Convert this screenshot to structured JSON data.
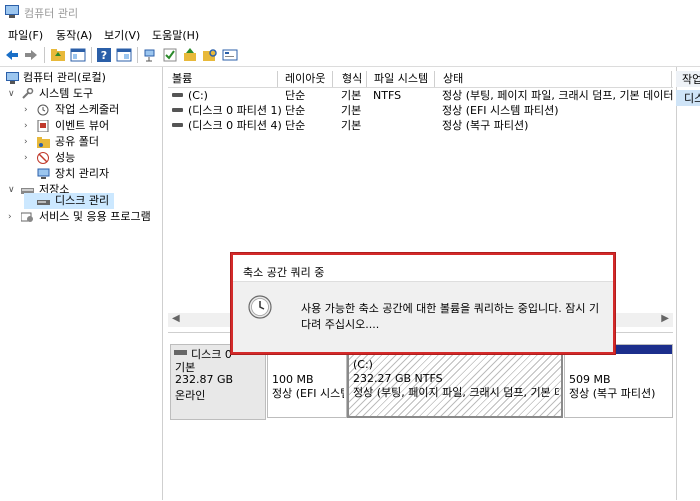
{
  "window": {
    "title": "컴퓨터 관리"
  },
  "menu": [
    "파일(F)",
    "동작(A)",
    "보기(V)",
    "도움말(H)"
  ],
  "tree": {
    "root": "컴퓨터 관리(로컬)",
    "system_tools": "시스템 도구",
    "task_scheduler": "작업 스케줄러",
    "event_viewer": "이벤트 뷰어",
    "shared_folders": "공유 폴더",
    "performance": "성능",
    "device_manager": "장치 관리자",
    "storage": "저장소",
    "disk_management": "디스크 관리",
    "services": "서비스 및 응용 프로그램"
  },
  "columns": [
    "볼륨",
    "레이아웃",
    "형식",
    "파일 시스템",
    "상태"
  ],
  "volumes": [
    {
      "name": "(C:)",
      "layout": "단순",
      "type": "기본",
      "fs": "NTFS",
      "status": "정상 (부팅, 페이지 파일, 크래시 덤프, 기본 데이터"
    },
    {
      "name": "(디스크 0 파티션 1)",
      "layout": "단순",
      "type": "기본",
      "fs": "",
      "status": "정상 (EFI 시스템 파티션)"
    },
    {
      "name": "(디스크 0 파티션 4)",
      "layout": "단순",
      "type": "기본",
      "fs": "",
      "status": "정상 (복구 파티션)"
    }
  ],
  "actions": {
    "header": "작업",
    "item": "디스크 관리"
  },
  "disk": {
    "name": "디스크 0",
    "type": "기본",
    "size": "232.87 GB",
    "state": "온라인",
    "partitions": [
      {
        "size": "100 MB",
        "status": "정상 (EFI 시스템 파티션)"
      },
      {
        "label": "(C:)",
        "size": "232.27 GB NTFS",
        "status": "정상 (부팅, 페이지 파일, 크래시 덤프, 기본 데이터)"
      },
      {
        "size": "509 MB",
        "status": "정상 (복구 파티션)"
      }
    ]
  },
  "dialog": {
    "title": "축소 공간 쿼리 중",
    "message": "사용 가능한 축소 공간에 대한 볼륨을 쿼리하는 중입니다. 잠시 기다려 주십시오...."
  },
  "colors": {
    "highlight": "#d32a2a",
    "partition_bar": "#1c2e8c",
    "selection": "#cce8ff"
  }
}
